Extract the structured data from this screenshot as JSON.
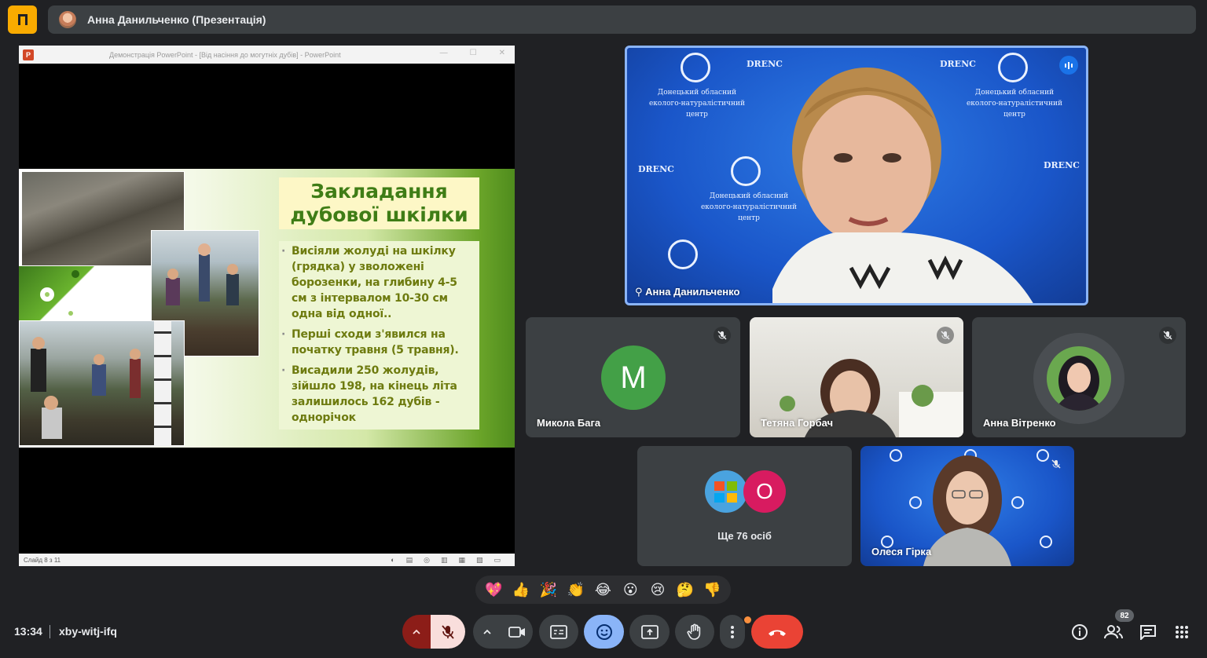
{
  "header": {
    "presenter_label": "Анна Данильченко (Презентація)"
  },
  "presentation": {
    "window_title": "Демонстрація PowerPoint - [Від насіння до могутніх дубів] - PowerPoint",
    "slide_title_line1": "Закладання",
    "slide_title_line2": "дубової шкілки",
    "bullets": [
      "Висіяли жолуді на шкілку (грядка) у зволожені борозенки, на глибину 4-5 см з інтервалом 10-30 см одна від одної..",
      "Перші сходи з'явился на початку травня (5 травня).",
      "Висадили 250 жолудів, зійшло 198, на кінець літа залишилось 162 дубів - однорічок"
    ],
    "status_text": "Слайд 8 з 11"
  },
  "participants": {
    "speaker": {
      "name": "Анна Данильченко",
      "bg_logo_text": "DRENC",
      "bg_org_text": "Донецький обласний еколого-натуралістичний центр"
    },
    "tile1": {
      "name": "Микола Бага",
      "initial": "M",
      "color": "#43a047"
    },
    "tile2": {
      "name": "Тетяна Горбач"
    },
    "tile3": {
      "name": "Анна Вітренко"
    },
    "others": {
      "label": "Ще 76 осіб",
      "initial": "О",
      "color": "#d81b60"
    },
    "tile5": {
      "name": "Олеся Гірка"
    }
  },
  "reactions": [
    "💖",
    "👍",
    "🎉",
    "👏",
    "😂",
    "😮",
    "😢",
    "🤔",
    "👎"
  ],
  "footer": {
    "time": "13:34",
    "meeting_code": "xby-witj-ifq",
    "people_count": "82"
  },
  "colors": {
    "background": "#202124",
    "tile": "#3c4043",
    "end_call": "#ea4335",
    "mic_off": "#f9dedc",
    "active_blue": "#8ab4f8"
  }
}
